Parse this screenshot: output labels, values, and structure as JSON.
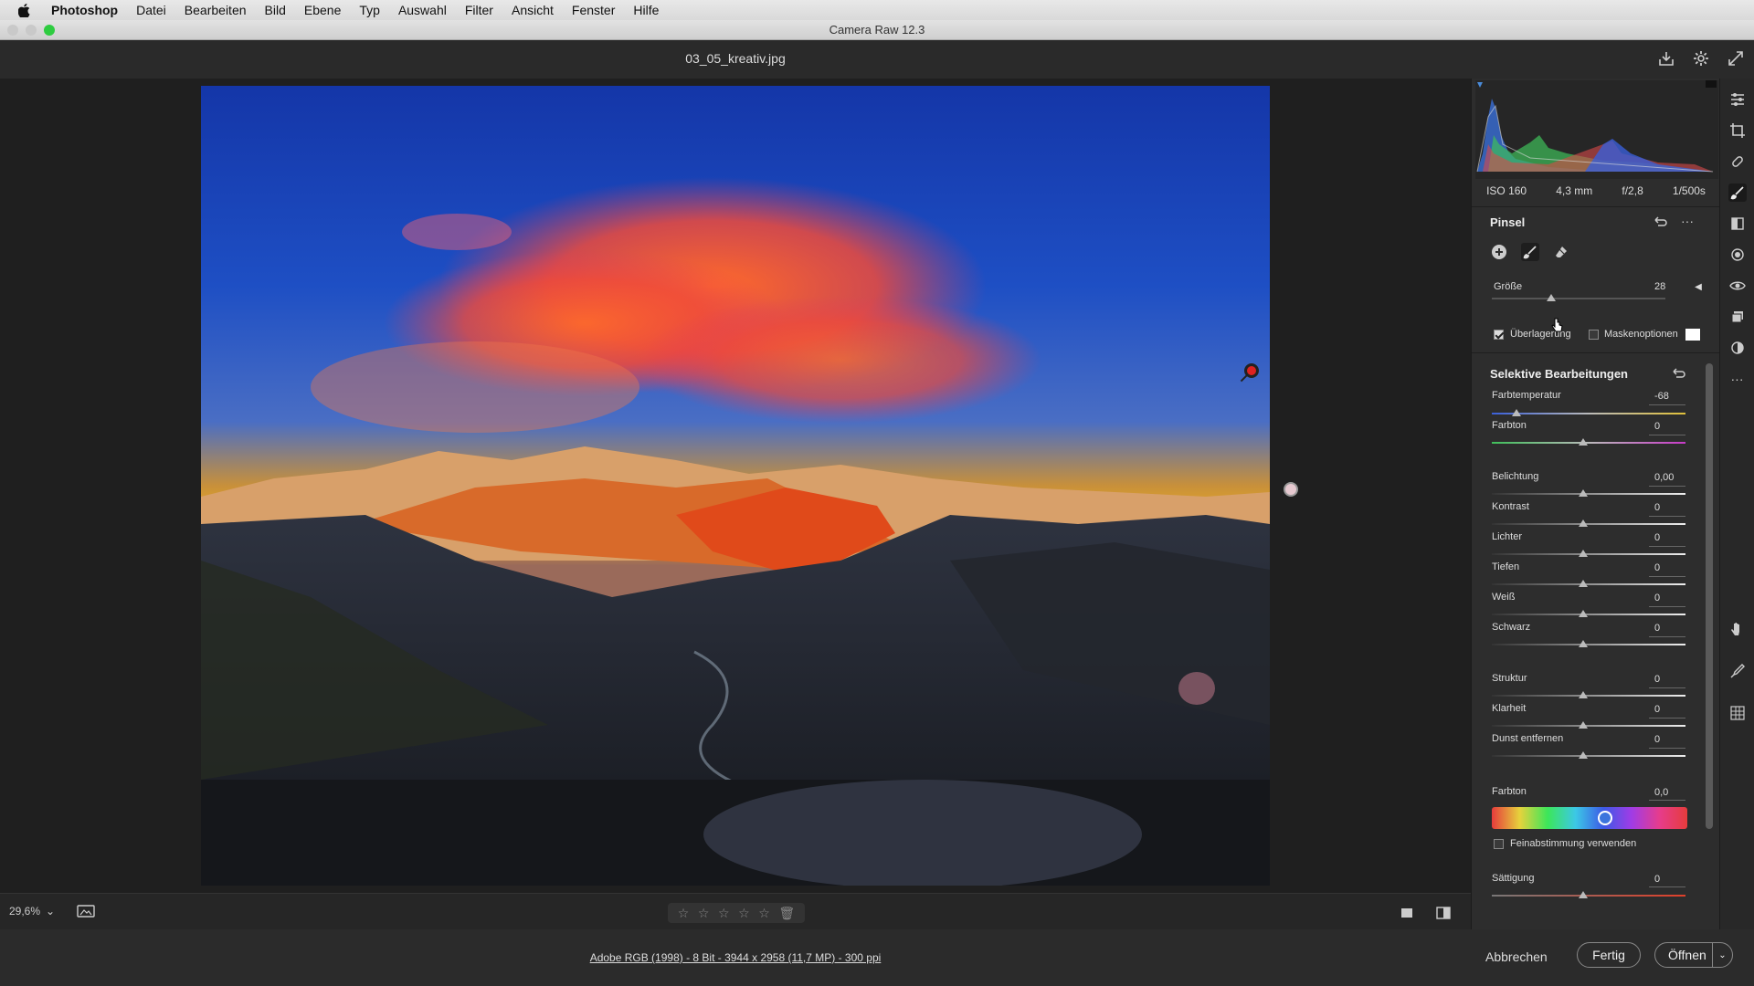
{
  "menubar": {
    "app": "Photoshop",
    "items": [
      "Datei",
      "Bearbeiten",
      "Bild",
      "Ebene",
      "Typ",
      "Auswahl",
      "Filter",
      "Ansicht",
      "Fenster",
      "Hilfe"
    ]
  },
  "window": {
    "title": "Camera Raw 12.3"
  },
  "topbar": {
    "filename": "03_05_kreativ.jpg"
  },
  "bottombar": {
    "zoom": "29,6%",
    "rating_stars": 5
  },
  "footer": {
    "info": "Adobe RGB (1998) - 8 Bit - 3944 x 2958 (11,7 MP) - 300 ppi",
    "cancel": "Abbrechen",
    "done": "Fertig",
    "open": "Öffnen"
  },
  "exif": {
    "iso": "ISO 160",
    "focal": "4,3 mm",
    "aperture": "f/2,8",
    "shutter": "1/500s"
  },
  "brush": {
    "title": "Pinsel",
    "size_label": "Größe",
    "size_value": "28",
    "overlay_label": "Überlagerung",
    "overlay_checked": true,
    "mask_label": "Maskenoptionen",
    "mask_checked": false
  },
  "selective": {
    "title": "Selektive Bearbeitungen",
    "sliders": [
      {
        "label": "Farbtemperatur",
        "value": "-68"
      },
      {
        "label": "Farbton",
        "value": "0"
      },
      {
        "label": "Belichtung",
        "value": "0,00"
      },
      {
        "label": "Kontrast",
        "value": "0"
      },
      {
        "label": "Lichter",
        "value": "0"
      },
      {
        "label": "Tiefen",
        "value": "0"
      },
      {
        "label": "Weiß",
        "value": "0"
      },
      {
        "label": "Schwarz",
        "value": "0"
      },
      {
        "label": "Struktur",
        "value": "0"
      },
      {
        "label": "Klarheit",
        "value": "0"
      },
      {
        "label": "Dunst entfernen",
        "value": "0"
      }
    ],
    "hue_label": "Farbton",
    "hue_value": "0,0",
    "fine_label": "Feinabstimmung verwenden",
    "saturation_label": "Sättigung",
    "saturation_value": "0"
  },
  "colors": {
    "accent": "#2ecc40",
    "panel": "#2d2d2d",
    "canvas": "#1f1f1f"
  }
}
